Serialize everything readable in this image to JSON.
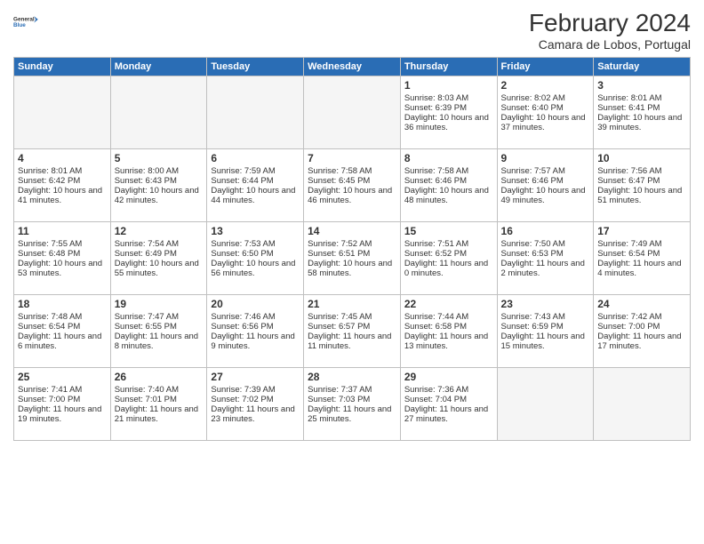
{
  "logo": {
    "line1": "General",
    "line2": "Blue"
  },
  "title": "February 2024",
  "subtitle": "Camara de Lobos, Portugal",
  "headers": [
    "Sunday",
    "Monday",
    "Tuesday",
    "Wednesday",
    "Thursday",
    "Friday",
    "Saturday"
  ],
  "weeks": [
    [
      {
        "day": "",
        "info": ""
      },
      {
        "day": "",
        "info": ""
      },
      {
        "day": "",
        "info": ""
      },
      {
        "day": "",
        "info": ""
      },
      {
        "day": "1",
        "info": "Sunrise: 8:03 AM\nSunset: 6:39 PM\nDaylight: 10 hours and 36 minutes."
      },
      {
        "day": "2",
        "info": "Sunrise: 8:02 AM\nSunset: 6:40 PM\nDaylight: 10 hours and 37 minutes."
      },
      {
        "day": "3",
        "info": "Sunrise: 8:01 AM\nSunset: 6:41 PM\nDaylight: 10 hours and 39 minutes."
      }
    ],
    [
      {
        "day": "4",
        "info": "Sunrise: 8:01 AM\nSunset: 6:42 PM\nDaylight: 10 hours and 41 minutes."
      },
      {
        "day": "5",
        "info": "Sunrise: 8:00 AM\nSunset: 6:43 PM\nDaylight: 10 hours and 42 minutes."
      },
      {
        "day": "6",
        "info": "Sunrise: 7:59 AM\nSunset: 6:44 PM\nDaylight: 10 hours and 44 minutes."
      },
      {
        "day": "7",
        "info": "Sunrise: 7:58 AM\nSunset: 6:45 PM\nDaylight: 10 hours and 46 minutes."
      },
      {
        "day": "8",
        "info": "Sunrise: 7:58 AM\nSunset: 6:46 PM\nDaylight: 10 hours and 48 minutes."
      },
      {
        "day": "9",
        "info": "Sunrise: 7:57 AM\nSunset: 6:46 PM\nDaylight: 10 hours and 49 minutes."
      },
      {
        "day": "10",
        "info": "Sunrise: 7:56 AM\nSunset: 6:47 PM\nDaylight: 10 hours and 51 minutes."
      }
    ],
    [
      {
        "day": "11",
        "info": "Sunrise: 7:55 AM\nSunset: 6:48 PM\nDaylight: 10 hours and 53 minutes."
      },
      {
        "day": "12",
        "info": "Sunrise: 7:54 AM\nSunset: 6:49 PM\nDaylight: 10 hours and 55 minutes."
      },
      {
        "day": "13",
        "info": "Sunrise: 7:53 AM\nSunset: 6:50 PM\nDaylight: 10 hours and 56 minutes."
      },
      {
        "day": "14",
        "info": "Sunrise: 7:52 AM\nSunset: 6:51 PM\nDaylight: 10 hours and 58 minutes."
      },
      {
        "day": "15",
        "info": "Sunrise: 7:51 AM\nSunset: 6:52 PM\nDaylight: 11 hours and 0 minutes."
      },
      {
        "day": "16",
        "info": "Sunrise: 7:50 AM\nSunset: 6:53 PM\nDaylight: 11 hours and 2 minutes."
      },
      {
        "day": "17",
        "info": "Sunrise: 7:49 AM\nSunset: 6:54 PM\nDaylight: 11 hours and 4 minutes."
      }
    ],
    [
      {
        "day": "18",
        "info": "Sunrise: 7:48 AM\nSunset: 6:54 PM\nDaylight: 11 hours and 6 minutes."
      },
      {
        "day": "19",
        "info": "Sunrise: 7:47 AM\nSunset: 6:55 PM\nDaylight: 11 hours and 8 minutes."
      },
      {
        "day": "20",
        "info": "Sunrise: 7:46 AM\nSunset: 6:56 PM\nDaylight: 11 hours and 9 minutes."
      },
      {
        "day": "21",
        "info": "Sunrise: 7:45 AM\nSunset: 6:57 PM\nDaylight: 11 hours and 11 minutes."
      },
      {
        "day": "22",
        "info": "Sunrise: 7:44 AM\nSunset: 6:58 PM\nDaylight: 11 hours and 13 minutes."
      },
      {
        "day": "23",
        "info": "Sunrise: 7:43 AM\nSunset: 6:59 PM\nDaylight: 11 hours and 15 minutes."
      },
      {
        "day": "24",
        "info": "Sunrise: 7:42 AM\nSunset: 7:00 PM\nDaylight: 11 hours and 17 minutes."
      }
    ],
    [
      {
        "day": "25",
        "info": "Sunrise: 7:41 AM\nSunset: 7:00 PM\nDaylight: 11 hours and 19 minutes."
      },
      {
        "day": "26",
        "info": "Sunrise: 7:40 AM\nSunset: 7:01 PM\nDaylight: 11 hours and 21 minutes."
      },
      {
        "day": "27",
        "info": "Sunrise: 7:39 AM\nSunset: 7:02 PM\nDaylight: 11 hours and 23 minutes."
      },
      {
        "day": "28",
        "info": "Sunrise: 7:37 AM\nSunset: 7:03 PM\nDaylight: 11 hours and 25 minutes."
      },
      {
        "day": "29",
        "info": "Sunrise: 7:36 AM\nSunset: 7:04 PM\nDaylight: 11 hours and 27 minutes."
      },
      {
        "day": "",
        "info": ""
      },
      {
        "day": "",
        "info": ""
      }
    ]
  ]
}
